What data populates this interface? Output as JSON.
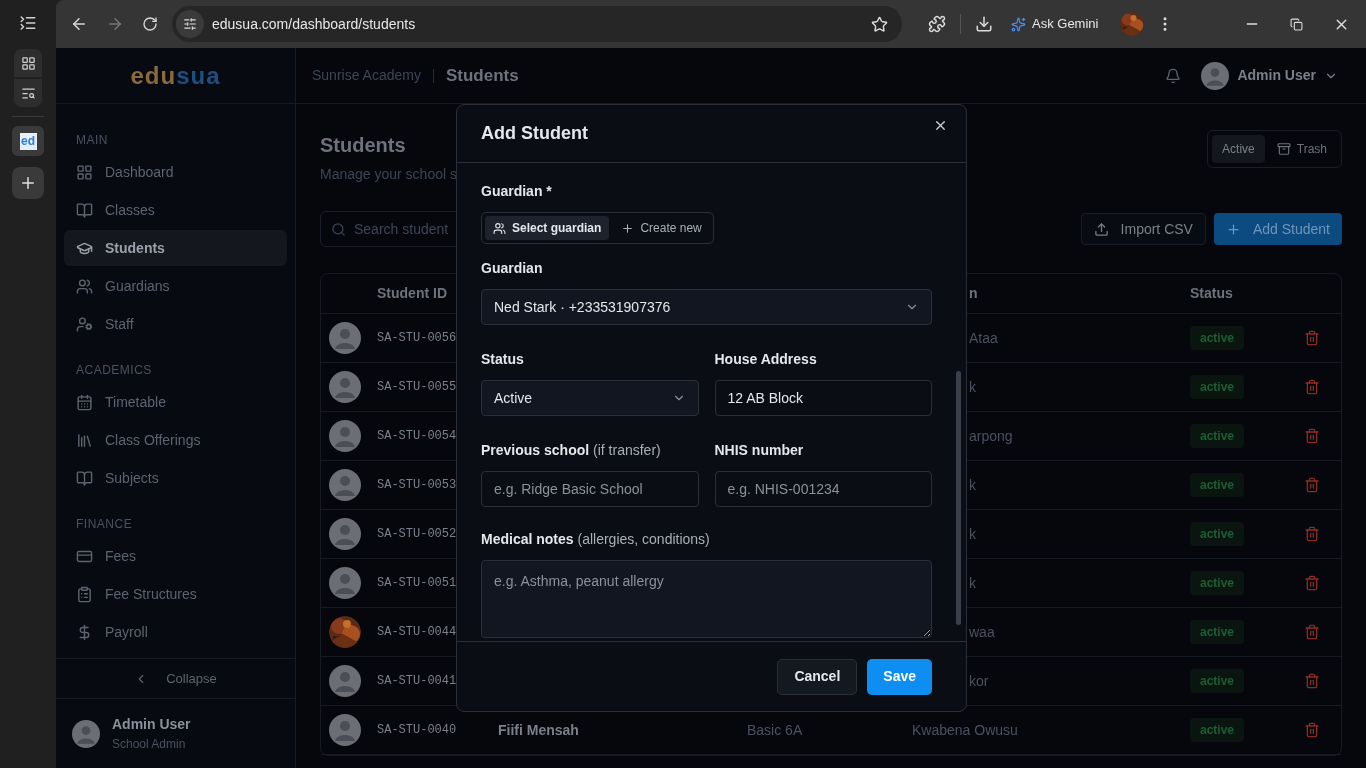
{
  "browser": {
    "url": "edusua.com/dashboard/students",
    "gemini": "Ask Gemini",
    "favicon": "ed"
  },
  "app": {
    "logo": [
      {
        "text": "edu",
        "color": "#8a6a3c"
      },
      {
        "text": "sua",
        "color": "#1d4f80"
      }
    ],
    "breadcrumb": {
      "school": "Sunrise Academy",
      "page": "Students"
    },
    "user": {
      "name": "Admin User"
    },
    "sidebar": {
      "sections": [
        {
          "label": "MAIN",
          "items": [
            {
              "label": "Dashboard",
              "selected": false
            },
            {
              "label": "Classes",
              "selected": false
            },
            {
              "label": "Students",
              "selected": true
            },
            {
              "label": "Guardians",
              "selected": false
            },
            {
              "label": "Staff",
              "selected": false
            }
          ]
        },
        {
          "label": "ACADEMICS",
          "items": [
            {
              "label": "Timetable",
              "selected": false
            },
            {
              "label": "Class Offerings",
              "selected": false
            },
            {
              "label": "Subjects",
              "selected": false
            }
          ]
        },
        {
          "label": "FINANCE",
          "items": [
            {
              "label": "Fees",
              "selected": false
            },
            {
              "label": "Fee Structures",
              "selected": false
            },
            {
              "label": "Payroll",
              "selected": false
            }
          ]
        }
      ],
      "collapse": "Collapse",
      "footer": {
        "name": "Admin User",
        "role": "School Admin"
      }
    },
    "page": {
      "title": "Students",
      "subtitle": "Manage your school s",
      "search": {
        "placeholder": "Search student"
      },
      "view_toggle": [
        {
          "label": "Active",
          "selected": true
        },
        {
          "label": "Trash",
          "selected": false
        }
      ],
      "import_button": "Import CSV",
      "add_button": "Add Student"
    },
    "table": {
      "columns": [
        {
          "label": "Student ID"
        },
        {
          "label": "n"
        },
        {
          "label": "Status"
        }
      ],
      "rows": [
        {
          "kind": "default",
          "id": "SA-STU-0056",
          "guardian": "Ataa",
          "status": "active"
        },
        {
          "kind": "default",
          "id": "SA-STU-0055",
          "guardian": "k",
          "status": "active"
        },
        {
          "kind": "default",
          "id": "SA-STU-0054",
          "guardian": "arpong",
          "status": "active"
        },
        {
          "kind": "default",
          "id": "SA-STU-0053",
          "guardian": "k",
          "status": "active"
        },
        {
          "kind": "default",
          "id": "SA-STU-0052",
          "guardian": "k",
          "status": "active"
        },
        {
          "kind": "default",
          "id": "SA-STU-0051",
          "guardian": "k",
          "status": "active"
        },
        {
          "kind": "picture",
          "id": "SA-STU-0044",
          "guardian": "waa",
          "status": "active"
        },
        {
          "kind": "default",
          "id": "SA-STU-0041",
          "guardian": "kor",
          "status": "active"
        },
        {
          "kind": "default",
          "id": "SA-STU-0040",
          "name": "Fiifi Mensah",
          "class": "Basic 6A",
          "guardian": "Kwabena Owusu",
          "status": "active"
        }
      ]
    }
  },
  "modal": {
    "title": "Add Student",
    "guardian_label": "Guardian *",
    "guardian_mode": [
      {
        "label": "Select guardian",
        "selected": true
      },
      {
        "label": "Create new",
        "selected": false
      }
    ],
    "guardian_select": {
      "label": "Guardian",
      "value": "Ned Stark · +233531907376"
    },
    "status": {
      "label": "Status",
      "value": "Active"
    },
    "address": {
      "label": "House Address",
      "value": "12 AB Block"
    },
    "previous_school": {
      "label": "Previous school",
      "hint": "(if transfer)",
      "placeholder": "e.g. Ridge Basic School"
    },
    "nhis": {
      "label": "NHIS number",
      "placeholder": "e.g. NHIS-001234"
    },
    "medical": {
      "label": "Medical notes",
      "hint": "(allergies, conditions)",
      "placeholder": "e.g. Asthma, peanut allergy"
    },
    "cancel": "Cancel",
    "save": "Save"
  }
}
